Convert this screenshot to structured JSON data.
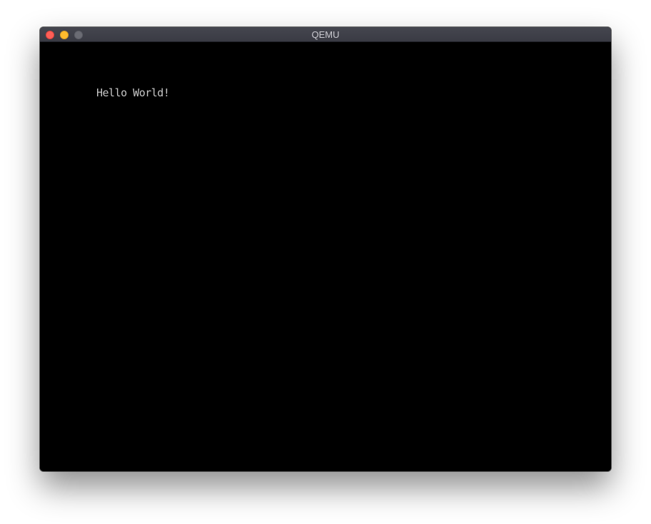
{
  "window": {
    "title": "QEMU"
  },
  "screen": {
    "text": "Hello World!",
    "text_color": "#c6c6c6",
    "background_color": "#000000"
  },
  "titlebar": {
    "controls": [
      "close-icon",
      "minimize-icon",
      "zoom-icon"
    ],
    "colors": {
      "close": "#fe5f57",
      "minimize": "#febc2e",
      "zoom": "#6b6c74"
    }
  }
}
